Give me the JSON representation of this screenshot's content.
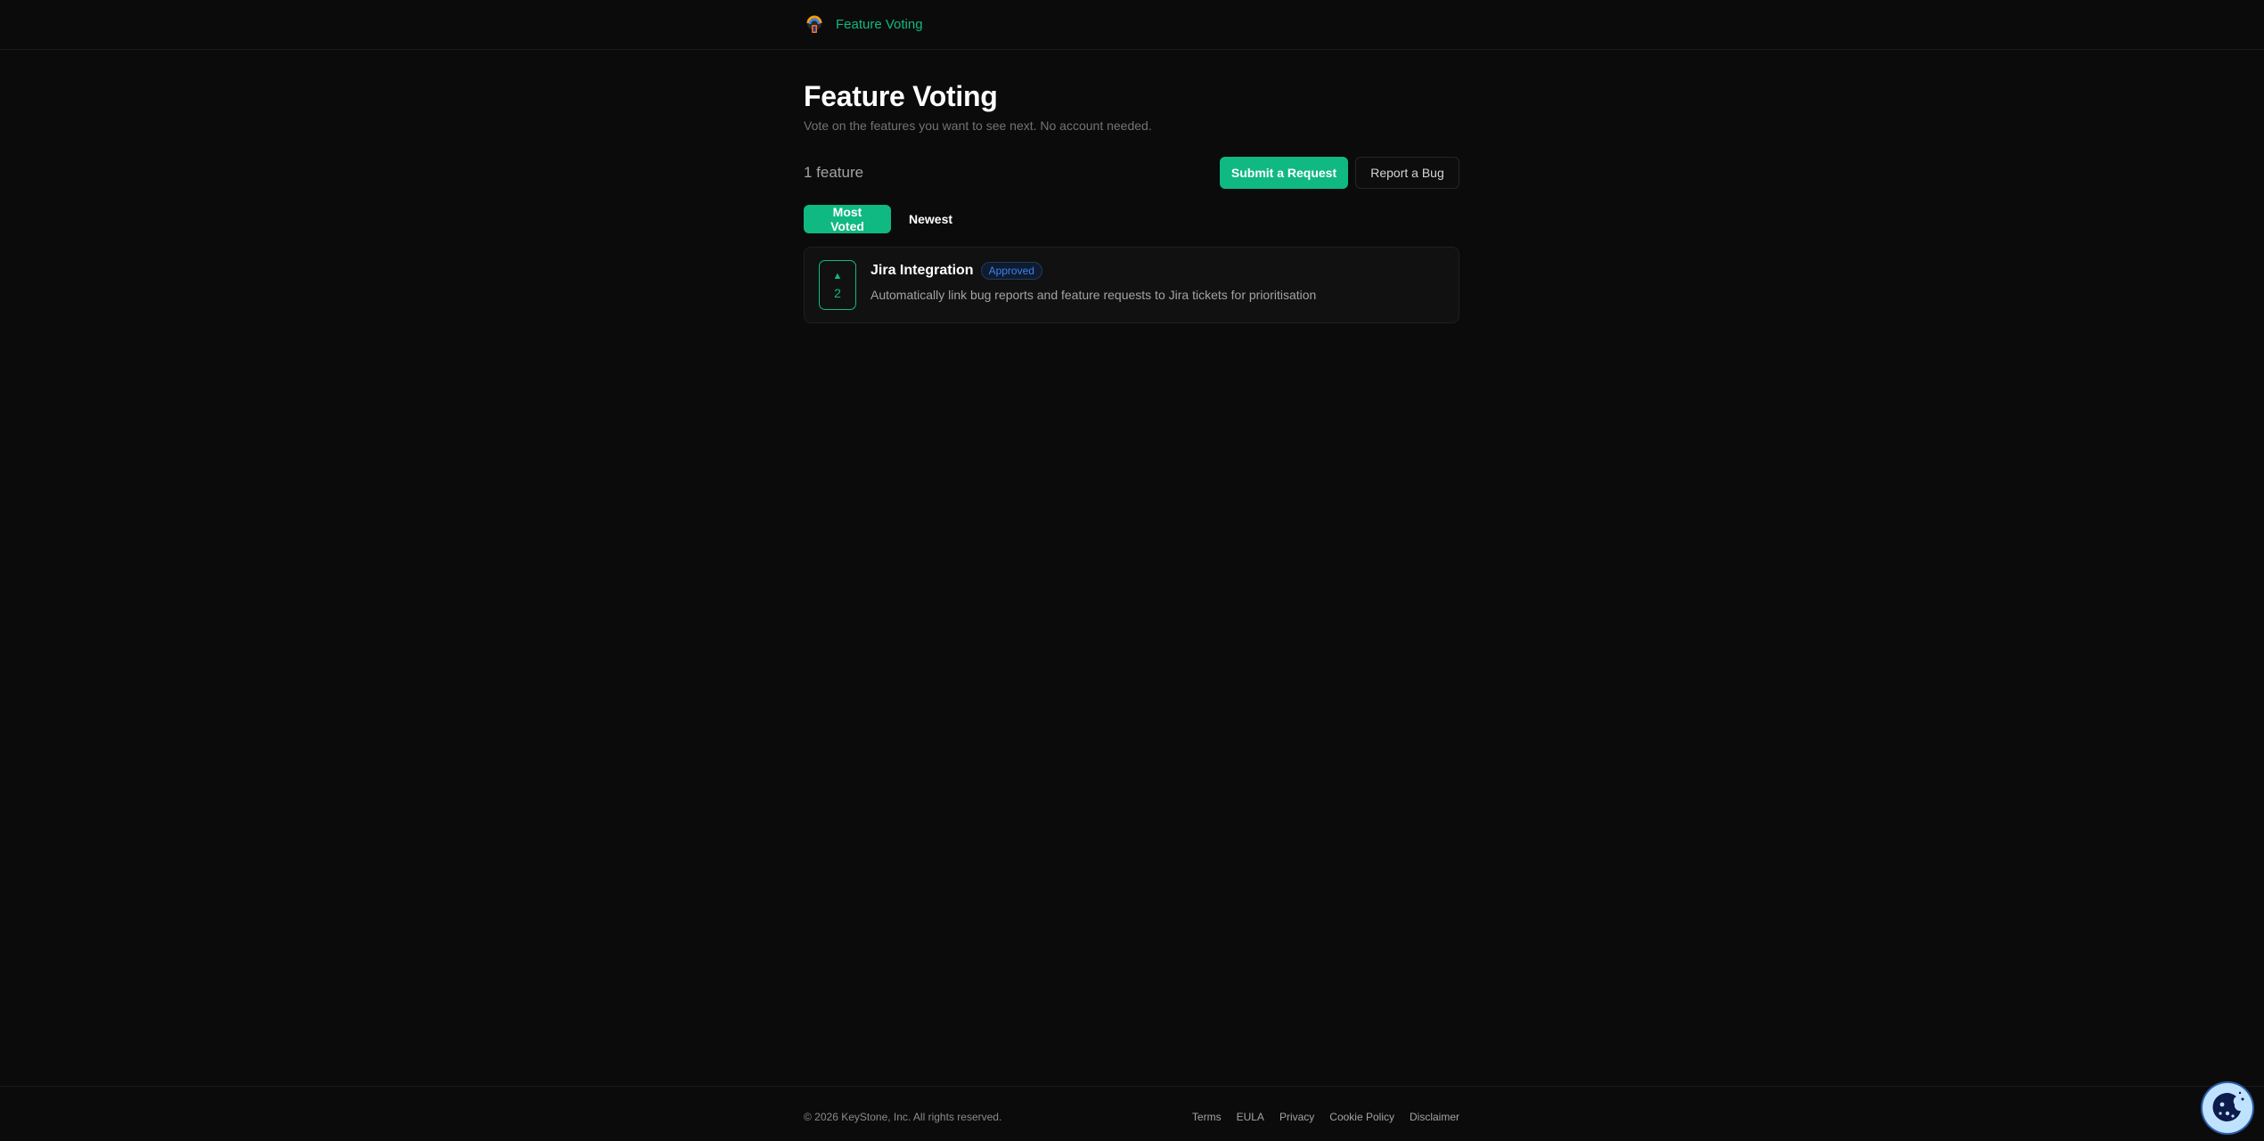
{
  "header": {
    "logo_icon": "keystone-logo-icon",
    "title": "Feature Voting"
  },
  "page": {
    "title": "Feature Voting",
    "subtitle": "Vote on the features you want to see next. No account needed.",
    "count_label": "1 feature"
  },
  "actions": {
    "submit_label": "Submit a Request",
    "bug_label": "Report a Bug"
  },
  "sort": {
    "options": [
      "Most Voted",
      "Newest"
    ],
    "active": "Most Voted"
  },
  "features": [
    {
      "title": "Jira Integration",
      "status": "Approved",
      "description": "Automatically link bug reports and feature requests to Jira tickets for prioritisation",
      "votes": "2",
      "vote_icon": "upvote-arrow-icon"
    }
  ],
  "footer": {
    "copyright": "© 2026 KeyStone, Inc. All rights reserved.",
    "links": [
      "Terms",
      "EULA",
      "Privacy",
      "Cookie Policy",
      "Disclaimer"
    ]
  },
  "cookie_icon": "cookie-icon",
  "colors": {
    "background": "#0b0b0b",
    "accent": "#10b981",
    "badge_blue": "#3b82f6",
    "card": "#111111",
    "cookie_button": "#2a5caa"
  }
}
